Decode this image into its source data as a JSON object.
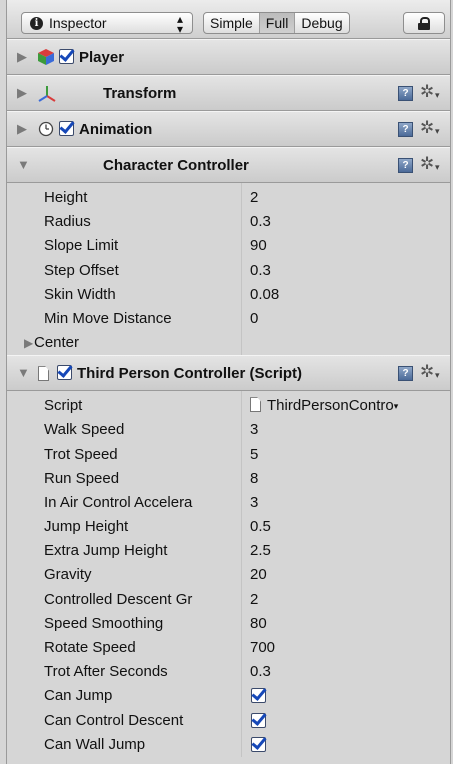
{
  "toolbar": {
    "tab_label": "Inspector",
    "modes": [
      "Simple",
      "Full",
      "Debug"
    ],
    "active_mode": "Full"
  },
  "components": {
    "player": {
      "title": "Player",
      "enabled": true
    },
    "transform": {
      "title": "Transform"
    },
    "animation": {
      "title": "Animation",
      "enabled": true
    },
    "character_controller": {
      "title": "Character Controller",
      "properties": [
        {
          "label": "Height",
          "value": "2"
        },
        {
          "label": "Radius",
          "value": "0.3"
        },
        {
          "label": "Slope Limit",
          "value": "90"
        },
        {
          "label": "Step Offset",
          "value": "0.3"
        },
        {
          "label": "Skin Width",
          "value": "0.08"
        },
        {
          "label": "Min Move Distance",
          "value": "0"
        }
      ],
      "center_label": "Center"
    },
    "third_person_controller": {
      "title": "Third Person Controller (Script)",
      "enabled": true,
      "script_label": "Script",
      "script_value": "ThirdPersonContro",
      "properties": [
        {
          "label": "Walk Speed",
          "value": "3"
        },
        {
          "label": "Trot Speed",
          "value": "5"
        },
        {
          "label": "Run Speed",
          "value": "8"
        },
        {
          "label": "In Air Control Accelera",
          "value": "3"
        },
        {
          "label": "Jump Height",
          "value": "0.5"
        },
        {
          "label": "Extra Jump Height",
          "value": "2.5"
        },
        {
          "label": "Gravity",
          "value": "20"
        },
        {
          "label": "Controlled Descent Gr",
          "value": "2"
        },
        {
          "label": "Speed Smoothing",
          "value": "80"
        },
        {
          "label": "Rotate Speed",
          "value": "700"
        },
        {
          "label": "Trot After Seconds",
          "value": "0.3"
        }
      ],
      "toggles": [
        {
          "label": "Can Jump",
          "checked": true
        },
        {
          "label": "Can Control Descent",
          "checked": true
        },
        {
          "label": "Can Wall Jump",
          "checked": true
        }
      ]
    }
  },
  "icons": {
    "info": "i",
    "help_book": "?",
    "gear": "✲"
  },
  "colors": {
    "checkmark": "#1648b8",
    "panel_bg": "#d6d6d6"
  }
}
